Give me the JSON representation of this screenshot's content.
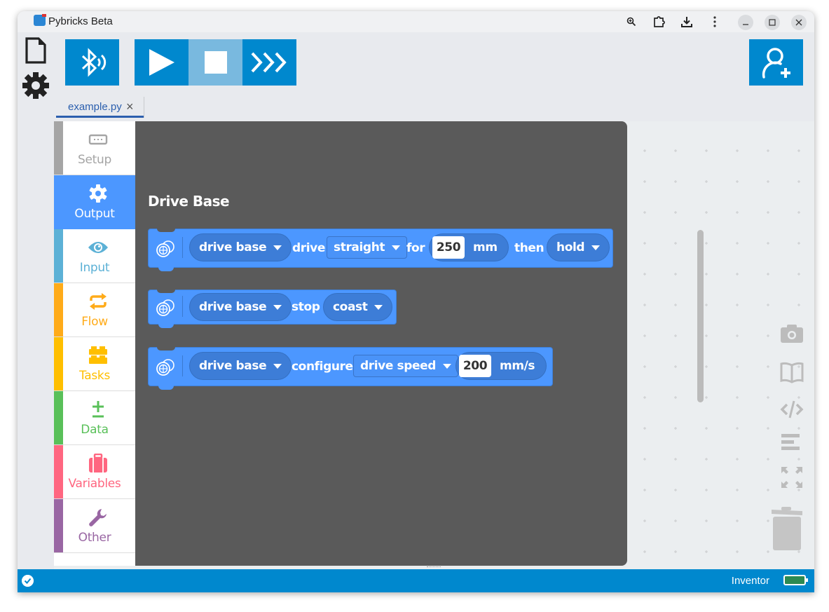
{
  "window": {
    "title": "Pybricks Beta",
    "titlebar_icons": [
      "zoom-icon",
      "extension-icon",
      "download-icon",
      "more-icon"
    ],
    "controls": [
      "minimize",
      "maximize",
      "close"
    ]
  },
  "left_sidebar": {
    "items": [
      {
        "name": "file-icon",
        "label": "Files"
      },
      {
        "name": "settings-icon",
        "label": "Settings"
      }
    ]
  },
  "toolbar": {
    "bluetooth_label": "Bluetooth",
    "run_label": "Run",
    "stop_label": "Stop",
    "repl_label": "REPL",
    "sponsor_label": "Sponsor"
  },
  "tabs": [
    {
      "label": "example.py",
      "active": true,
      "close": "×"
    }
  ],
  "toolbox": {
    "categories": [
      {
        "label": "Setup",
        "color": "#a5a5a5",
        "icon": "hub-icon"
      },
      {
        "label": "Output",
        "color": "#4c97ff",
        "icon": "gear-icon",
        "selected": true
      },
      {
        "label": "Input",
        "color": "#5cb1d6",
        "icon": "eye-icon"
      },
      {
        "label": "Flow",
        "color": "#ffab19",
        "icon": "loop-icon"
      },
      {
        "label": "Tasks",
        "color": "#ffbf00",
        "icon": "brick-icon"
      },
      {
        "label": "Data",
        "color": "#59c059",
        "icon": "plus-minus-icon"
      },
      {
        "label": "Variables",
        "color": "#ff6680",
        "icon": "suitcase-icon"
      },
      {
        "label": "Other",
        "color": "#9966a3",
        "icon": "wrench-icon"
      }
    ]
  },
  "flyout": {
    "title": "Drive Base",
    "blocks": [
      {
        "device": "drive base",
        "verb1": "drive",
        "mode": "straight",
        "verb2": "for",
        "value": "250",
        "unit": "mm",
        "verb3": "then",
        "then": "hold"
      },
      {
        "device": "drive base",
        "verb1": "stop",
        "mode": "coast"
      },
      {
        "device": "drive base",
        "verb1": "configure",
        "mode": "drive speed",
        "value": "200",
        "unit": "mm/s"
      }
    ]
  },
  "workspace_tools": [
    "camera-icon",
    "docs-icon",
    "code-icon",
    "cleanup-icon",
    "zoom-fit-icon",
    "trash-icon"
  ],
  "statusbar": {
    "hub_name": "Inventor",
    "battery_color": "#2c8a52"
  },
  "colors": {
    "accent": "#0088ce",
    "block": "#4c97ff",
    "flyout_bg": "#5a5a5a"
  }
}
